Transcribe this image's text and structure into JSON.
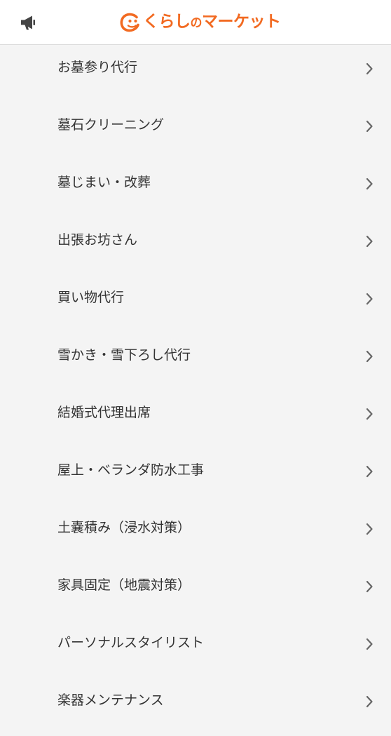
{
  "colors": {
    "brand": "#f26a21",
    "background": "#f4f4f4",
    "header_background": "#ffffff",
    "text": "#333333",
    "icon": "#444444",
    "chevron": "#666666"
  },
  "header": {
    "notice_icon": "megaphone-icon",
    "logo_text": "くらしのマーケット"
  },
  "services": [
    {
      "label": "お墓参り代行"
    },
    {
      "label": "墓石クリーニング"
    },
    {
      "label": "墓じまい・改葬"
    },
    {
      "label": "出張お坊さん"
    },
    {
      "label": "買い物代行"
    },
    {
      "label": "雪かき・雪下ろし代行"
    },
    {
      "label": "結婚式代理出席"
    },
    {
      "label": "屋上・ベランダ防水工事"
    },
    {
      "label": "土嚢積み（浸水対策）"
    },
    {
      "label": "家具固定（地震対策）"
    },
    {
      "label": "パーソナルスタイリスト"
    },
    {
      "label": "楽器メンテナンス"
    }
  ],
  "row_icon": "chevron-right-icon"
}
